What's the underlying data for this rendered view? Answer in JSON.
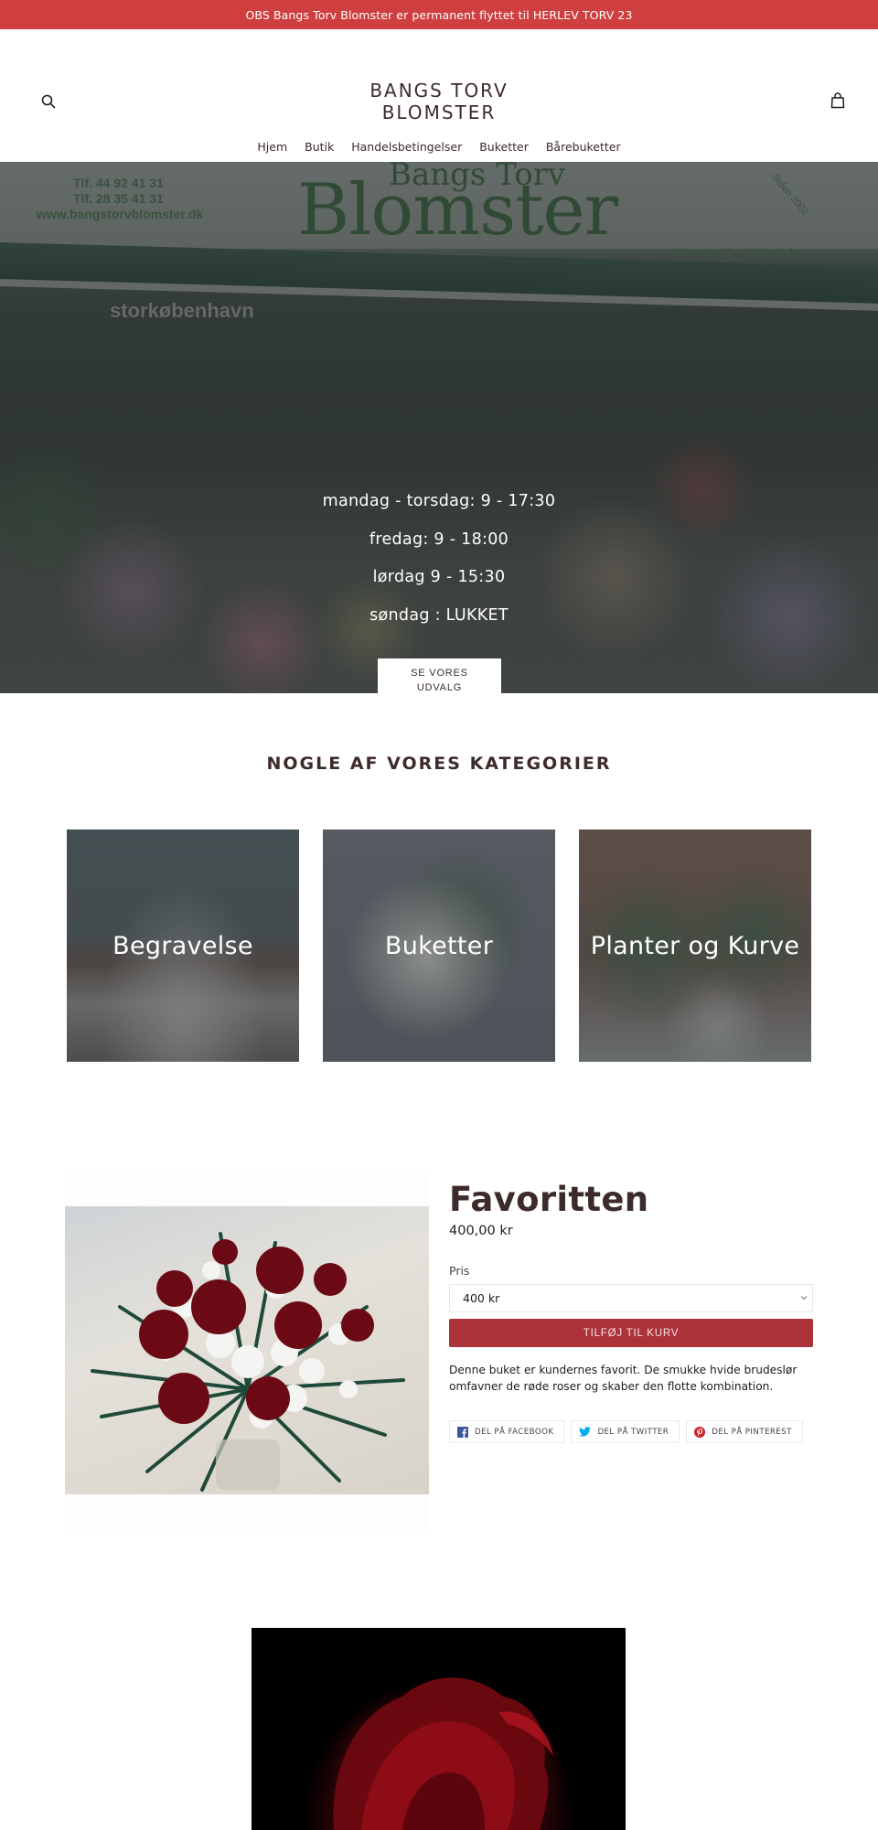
{
  "announcement": {
    "text": "OBS Bangs Torv Blomster er permanent flyttet til HERLEV TORV 23"
  },
  "header": {
    "logo_line1": "BANGS TORV",
    "logo_line2": "BLOMSTER",
    "search_icon": "search-icon",
    "cart_icon": "shopping-bag-icon",
    "nav": [
      {
        "label": "Hjem"
      },
      {
        "label": "Butik"
      },
      {
        "label": "Handelsbetingelser"
      },
      {
        "label": "Buketter"
      },
      {
        "label": "Bårebuketter"
      }
    ]
  },
  "hero": {
    "sign": {
      "name_small": "Bangs Torv",
      "name_big": "Blomster",
      "phone1": "Tlf. 44 92 41 31",
      "phone2": "Tlf. 28 35 41 31",
      "website": "www.bangstorvblomster.dk",
      "since": "Siden 2002",
      "tagline": "Blomster Vin Chokolade",
      "window_text": "storkøbenhavn"
    },
    "hours": [
      "mandag - torsdag: 9 - 17:30",
      "fredag: 9 - 18:00",
      "lørdag 9 - 15:30",
      "søndag : LUKKET"
    ],
    "button_line1": "SE VORES",
    "button_line2": "UDVALG"
  },
  "categories": {
    "title": "NOGLE AF VORES KATEGORIER",
    "items": [
      {
        "label": "Begravelse"
      },
      {
        "label": "Buketter"
      },
      {
        "label": "Planter og Kurve"
      }
    ]
  },
  "product": {
    "title": "Favoritten",
    "price": "400,00 kr",
    "option_label": "Pris",
    "option_selected": "400 kr",
    "add_to_cart": "TILFØJ TIL KURV",
    "description": "Denne buket er kundernes favorit. De smukke hvide brudeslør omfavner de røde roser og skaber den flotte kombination.",
    "share": [
      {
        "label": "DEL PÅ FACEBOOK",
        "icon": "facebook-icon",
        "color": "#3b5998"
      },
      {
        "label": "DEL PÅ TWITTER",
        "icon": "twitter-icon",
        "color": "#00aced"
      },
      {
        "label": "DEL PÅ PINTEREST",
        "icon": "pinterest-icon",
        "color": "#cb2027"
      }
    ]
  },
  "colors": {
    "announcement_bg": "#cf3f3f",
    "accent_button": "#ac3339",
    "text_primary": "#3d2b2b"
  }
}
